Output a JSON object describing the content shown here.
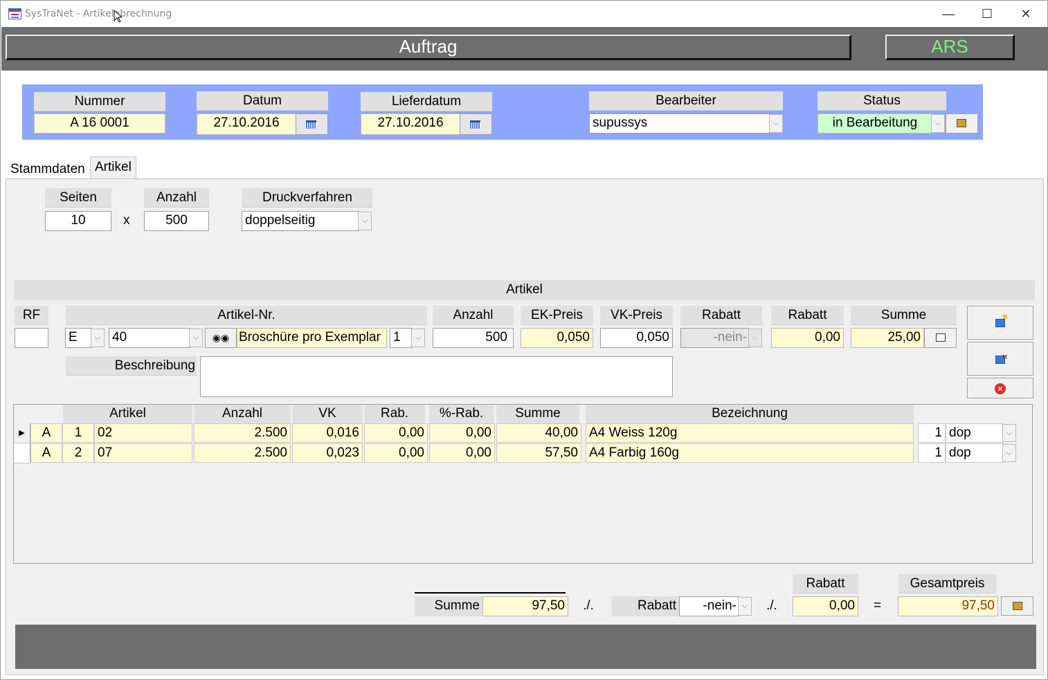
{
  "window": {
    "title": "SysTraNet - Artikelabrechnung",
    "minimize": "—",
    "maximize": "☐",
    "close": "✕"
  },
  "header": {
    "title": "Auftrag",
    "badge": "ARS"
  },
  "order": {
    "nummer_label": "Nummer",
    "nummer": "A 16 0001",
    "datum_label": "Datum",
    "datum": "27.10.2016",
    "lieferdatum_label": "Lieferdatum",
    "lieferdatum": "27.10.2016",
    "bearbeiter_label": "Bearbeiter",
    "bearbeiter": "supussys",
    "status_label": "Status",
    "status": "in Bearbeitung"
  },
  "tabs": [
    "Stammdaten",
    "Artikel"
  ],
  "druck": {
    "seiten_label": "Seiten",
    "seiten": "10",
    "x": "x",
    "anzahl_label": "Anzahl",
    "anzahl": "500",
    "verfahren_label": "Druckverfahren",
    "verfahren": "doppelseitig"
  },
  "artikel": {
    "section_title": "Artikel",
    "rf_label": "RF",
    "rf": "",
    "nr_label": "Artikel-Nr.",
    "typ": "E",
    "nr": "40",
    "bezeichnung": "Broschüre pro Exemplar",
    "variante": "1",
    "anzahl_label": "Anzahl",
    "anzahl": "500",
    "ek_label": "EK-Preis",
    "ek": "0,050",
    "vk_label": "VK-Preis",
    "vk": "0,050",
    "rabatt1_label": "Rabatt",
    "rabatt1": "-nein-",
    "rabatt2_label": "Rabatt",
    "rabatt2": "0,00",
    "summe_label": "Summe",
    "summe": "25,00",
    "beschreibung_label": "Beschreibung",
    "beschreibung": ""
  },
  "table": {
    "headers": [
      "Artikel",
      "Anzahl",
      "VK",
      "Rab.",
      "%-Rab.",
      "Summe",
      "Bezeichnung"
    ],
    "rows": [
      {
        "typ": "A",
        "pos": "1",
        "artikel": "02",
        "anzahl": "2.500",
        "vk": "0,016",
        "rab": "0,00",
        "prab": "0,00",
        "summe": "40,00",
        "bezeichnung": "A4 Weiss 120g",
        "menge": "1",
        "druck": "dop"
      },
      {
        "typ": "A",
        "pos": "2",
        "artikel": "07",
        "anzahl": "2.500",
        "vk": "0,023",
        "rab": "0,00",
        "prab": "0,00",
        "summe": "57,50",
        "bezeichnung": "A4 Farbig 160g",
        "menge": "1",
        "druck": "dop"
      }
    ]
  },
  "totals": {
    "summe_label": "Summe",
    "summe": "97,50",
    "sep1": "./.",
    "rabatt_label": "Rabatt",
    "rabatt_sel": "-nein-",
    "sep2": "./.",
    "rabatt_value_label": "Rabatt",
    "rabatt_value": "0,00",
    "eq": "=",
    "gesamt_label": "Gesamtpreis",
    "gesamt": "97,50"
  },
  "colors": {
    "band": "#6e6e6e",
    "panel": "#8fa6ff",
    "field": "#fdfbd3",
    "status": "#ccffcc",
    "badge": "#7cf07c",
    "gesamt_text": "#8b3a00"
  }
}
